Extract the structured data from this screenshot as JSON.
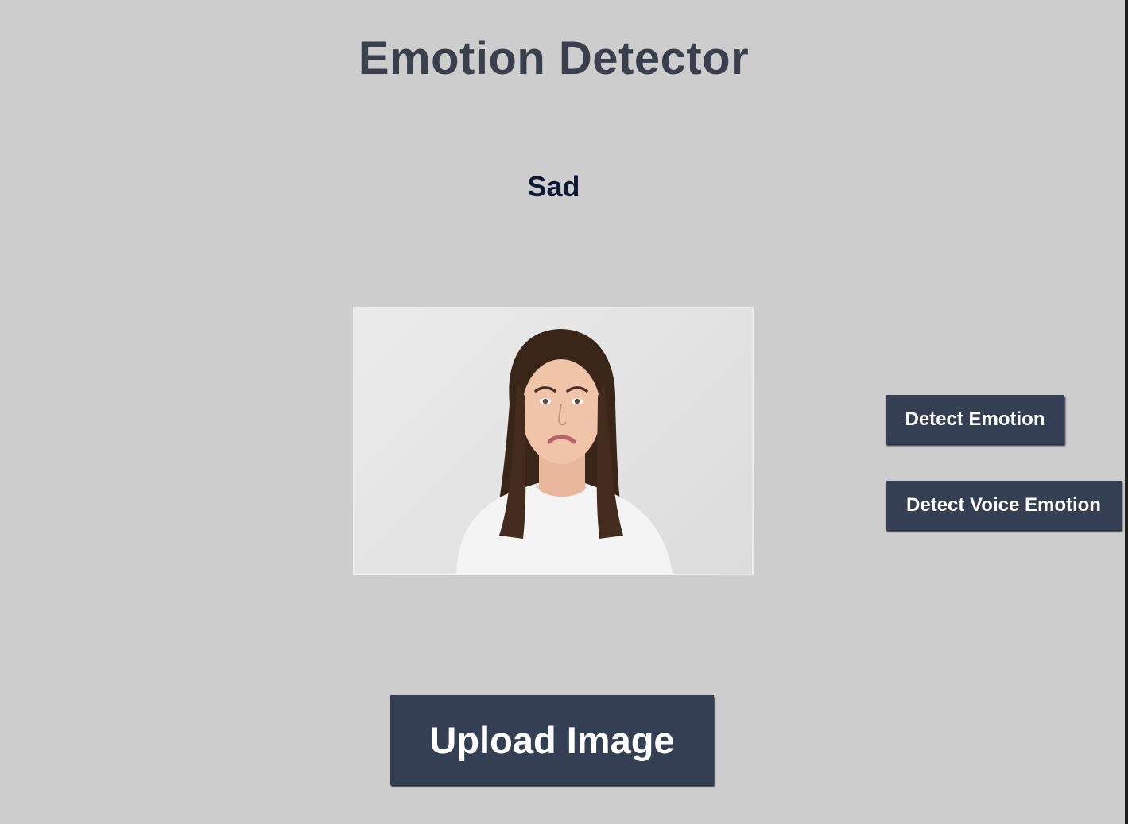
{
  "app": {
    "title": "Emotion Detector",
    "result_label": "Sad"
  },
  "image": {
    "description_icon": "uploaded-face-photo"
  },
  "buttons": {
    "detect_emotion": "Detect Emotion",
    "detect_voice_emotion": "Detect Voice Emotion",
    "upload_image": "Upload Image"
  },
  "colors": {
    "background": "#cdcdcd",
    "button_bg": "#353f53",
    "button_text": "#ffffff",
    "title_text": "#3a3f4e",
    "result_text": "#0e1a33"
  }
}
